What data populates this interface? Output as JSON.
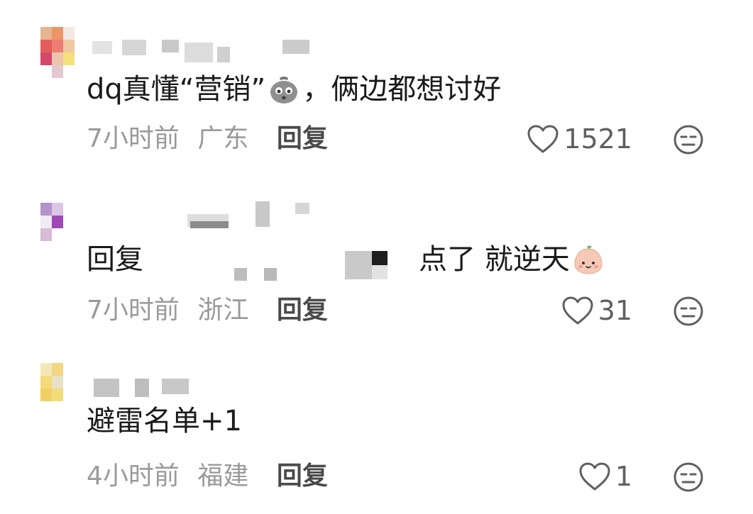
{
  "comments": [
    {
      "text": "dq真懂“营销”",
      "text_after": "，俩边都想讨好",
      "emoji": "frowning-bag-emoji",
      "time": "7小时前",
      "region": "广东",
      "reply_label": "回复",
      "likes": "1521"
    },
    {
      "reply_prefix": "回复",
      "text": "点了 就逆天",
      "emoji": "smiling-peach-emoji",
      "time": "7小时前",
      "region": "浙江",
      "reply_label": "回复",
      "likes": "31"
    },
    {
      "text": "避雷名单+1",
      "time": "4小时前",
      "region": "福建",
      "reply_label": "回复",
      "likes": "1"
    }
  ],
  "colors": {
    "meta_gray": "#9a9a9a",
    "text": "#1a1a1a",
    "icon_gray": "#5f5f5f"
  }
}
